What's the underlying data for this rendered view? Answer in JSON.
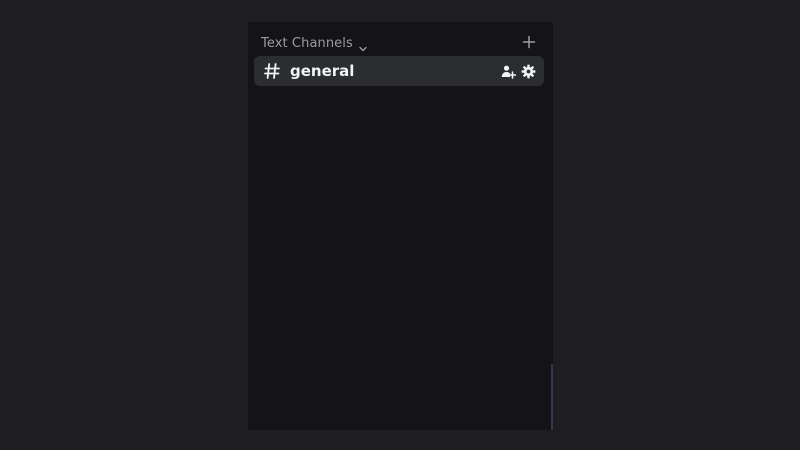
{
  "sidebar": {
    "category": {
      "label": "Text Channels",
      "chevron_icon": "chevron-down-icon",
      "add_icon": "plus-icon"
    },
    "channels": [
      {
        "name": "general",
        "icon": "hash-icon",
        "actions": [
          "invite-icon",
          "gear-icon"
        ]
      }
    ]
  },
  "colors": {
    "background": "#1e1e22",
    "panel": "#141416",
    "channel_selected": "#2c2d31",
    "category_text": "#9a9ba3",
    "channel_text": "#f2f3f5"
  }
}
